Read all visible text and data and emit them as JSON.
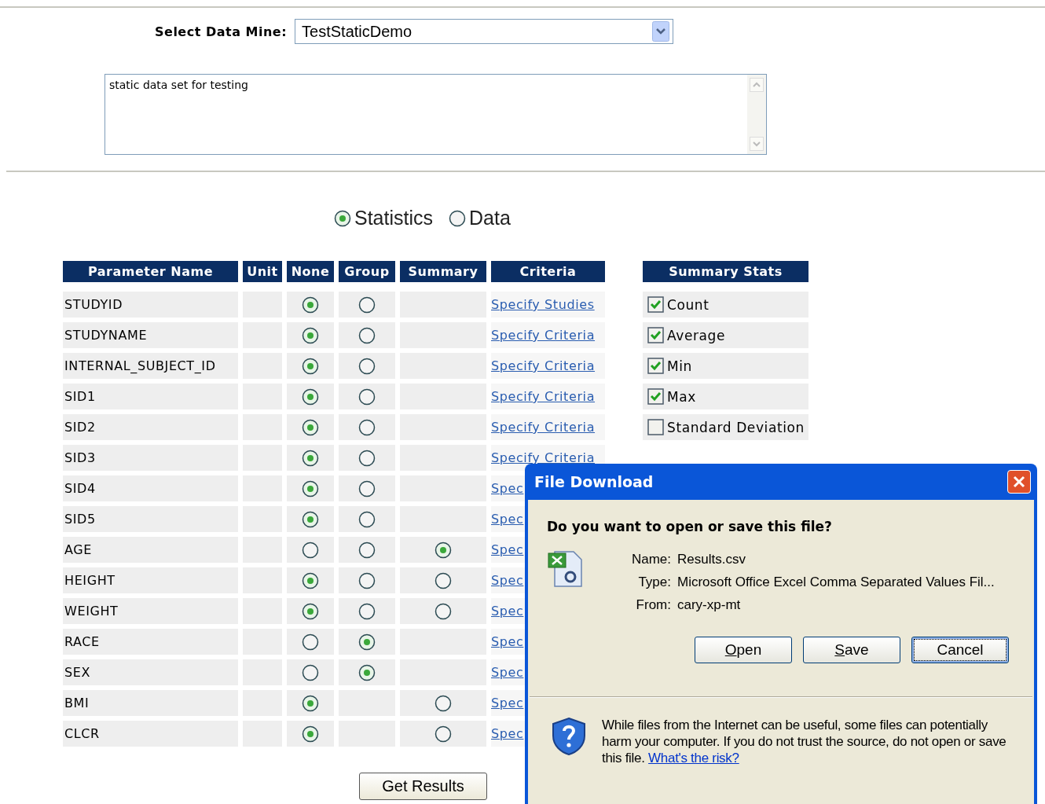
{
  "data_mine": {
    "label": "Select Data Mine:",
    "value": "TestStaticDemo"
  },
  "description": {
    "value": "static data set for testing"
  },
  "mode": [
    {
      "label": "Statistics",
      "selected": true
    },
    {
      "label": "Data",
      "selected": false
    }
  ],
  "table": {
    "columns": [
      "Parameter Name",
      "Unit",
      "None",
      "Group",
      "Summary",
      "Criteria"
    ],
    "rows": [
      {
        "name": "STUDYID",
        "none": {
          "selected": true
        },
        "group": {
          "selected": false
        },
        "criteria": "Specify Studies"
      },
      {
        "name": "STUDYNAME",
        "none": {
          "selected": true
        },
        "group": {
          "selected": false
        },
        "criteria": "Specify Criteria"
      },
      {
        "name": "INTERNAL_SUBJECT_ID",
        "none": {
          "selected": true
        },
        "group": {
          "selected": false
        },
        "criteria": "Specify Criteria"
      },
      {
        "name": "SID1",
        "none": {
          "selected": true
        },
        "group": {
          "selected": false
        },
        "criteria": "Specify Criteria"
      },
      {
        "name": "SID2",
        "none": {
          "selected": true
        },
        "group": {
          "selected": false
        },
        "criteria": "Specify Criteria"
      },
      {
        "name": "SID3",
        "none": {
          "selected": true
        },
        "group": {
          "selected": false
        },
        "criteria": "Specify Criteria"
      },
      {
        "name": "SID4",
        "none": {
          "selected": true
        },
        "group": {
          "selected": false
        },
        "criteria": "Spec"
      },
      {
        "name": "SID5",
        "none": {
          "selected": true
        },
        "group": {
          "selected": false
        },
        "criteria": "Spec"
      },
      {
        "name": "AGE",
        "none": {
          "selected": false
        },
        "group": {
          "selected": false
        },
        "summary": {
          "selected": true
        },
        "criteria": "Spec"
      },
      {
        "name": "HEIGHT",
        "none": {
          "selected": true
        },
        "group": {
          "selected": false
        },
        "summary": {
          "selected": false
        },
        "criteria": "Spec"
      },
      {
        "name": "WEIGHT",
        "none": {
          "selected": true
        },
        "group": {
          "selected": false
        },
        "summary": {
          "selected": false
        },
        "criteria": "Spec"
      },
      {
        "name": "RACE",
        "none": {
          "selected": false
        },
        "group": {
          "selected": true
        },
        "criteria": "Spec"
      },
      {
        "name": "SEX",
        "none": {
          "selected": false
        },
        "group": {
          "selected": true
        },
        "criteria": "Spec"
      },
      {
        "name": "BMI",
        "none": {
          "selected": true
        },
        "summary": {
          "selected": false
        },
        "criteria": "Spec"
      },
      {
        "name": "CLCR",
        "none": {
          "selected": true
        },
        "summary": {
          "selected": false
        },
        "criteria": "Spec"
      }
    ]
  },
  "summary_stats": {
    "title": "Summary Stats",
    "items": [
      {
        "label": "Count",
        "checked": true
      },
      {
        "label": "Average",
        "checked": true
      },
      {
        "label": "Min",
        "checked": true
      },
      {
        "label": "Max",
        "checked": true
      },
      {
        "label": "Standard Deviation",
        "checked": false
      }
    ]
  },
  "get_results_button": "Get Results",
  "dialog": {
    "title": "File Download",
    "question": "Do you want to open or save this file?",
    "fields": [
      {
        "label": "Name:",
        "value": "Results.csv"
      },
      {
        "label": "Type:",
        "value": "Microsoft Office Excel Comma Separated Values Fil..."
      },
      {
        "label": "From:",
        "value": "cary-xp-mt"
      }
    ],
    "buttons": [
      {
        "label": "Open",
        "underline_first": true,
        "focused": false
      },
      {
        "label": "Save",
        "underline_first": true,
        "focused": false
      },
      {
        "label": "Cancel",
        "underline_first": false,
        "focused": true
      }
    ],
    "warning": "While files from the Internet can be useful, some files can potentially harm your computer. If you do not trust the source, do not open or save this file.",
    "risk_link": "What's the risk?"
  }
}
